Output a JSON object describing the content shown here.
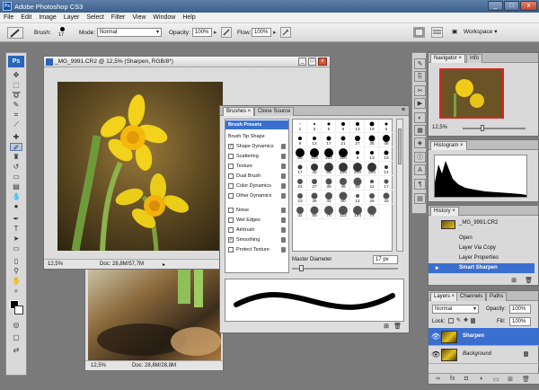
{
  "app": {
    "title": "Adobe Photoshop CS3",
    "logo": "Ps"
  },
  "window_controls": {
    "minimize": "_",
    "maximize": "□",
    "close": "x"
  },
  "menu": [
    "File",
    "Edit",
    "Image",
    "Layer",
    "Select",
    "Filter",
    "View",
    "Window",
    "Help"
  ],
  "options_bar": {
    "brush_label": "Brush:",
    "brush_size": "17",
    "mode_label": "Mode:",
    "mode_value": "Normal",
    "opacity_label": "Opacity:",
    "opacity_value": "100%",
    "flow_label": "Flow:",
    "flow_value": "100%",
    "workspace_label": "Workspace ▾"
  },
  "document_front": {
    "title": "_MG_9991.CR2 @ 12,5% (Sharpen, RGB/8*)",
    "zoom": "12,5%",
    "doc_info": "Doc: 28,8M/57,7M"
  },
  "document_back": {
    "zoom": "12,5%",
    "doc_info": "Doc: 28,8M/28,8M"
  },
  "brushes_panel": {
    "tabs": [
      "Brushes ×",
      "Clone Source"
    ],
    "presets_header": "Brush Presets",
    "tip_shape": "Brush Tip Shape",
    "options": [
      {
        "label": "Shape Dynamics",
        "checked": true,
        "check": "✓"
      },
      {
        "label": "Scattering",
        "checked": false,
        "check": ""
      },
      {
        "label": "Texture",
        "checked": false,
        "check": ""
      },
      {
        "label": "Dual Brush",
        "checked": false,
        "check": ""
      },
      {
        "label": "Color Dynamics",
        "checked": false,
        "check": ""
      },
      {
        "label": "Other Dynamics",
        "checked": false,
        "check": ""
      },
      {
        "label": "Noise",
        "checked": false,
        "check": ""
      },
      {
        "label": "Wet Edges",
        "checked": false,
        "check": ""
      },
      {
        "label": "Airbrush",
        "checked": false,
        "check": ""
      },
      {
        "label": "Smoothing",
        "checked": true,
        "check": "✓"
      },
      {
        "label": "Protect Texture",
        "checked": false,
        "check": ""
      }
    ],
    "brush_sizes": [
      "1",
      "3",
      "5",
      "9",
      "13",
      "19",
      "5",
      "9",
      "13",
      "17",
      "21",
      "27",
      "35",
      "45",
      "65",
      "100",
      "200",
      "300",
      "9",
      "13",
      "19",
      "17",
      "45",
      "65",
      "100",
      "200",
      "300",
      "14",
      "24",
      "27",
      "39",
      "46",
      "59",
      "11",
      "17",
      "23",
      "36",
      "44",
      "60",
      "14",
      "26",
      "33",
      "42",
      "55",
      "70",
      "112",
      "134",
      "74"
    ],
    "master_diameter_label": "Master Diameter",
    "master_diameter_value": "17 px"
  },
  "navigator_panel": {
    "tabs": [
      "Navigator ×",
      "Info"
    ],
    "zoom": "12,5%"
  },
  "histogram_panel": {
    "tabs": [
      "Histogram ×"
    ]
  },
  "history_panel": {
    "tabs": [
      "History ×"
    ],
    "snapshot": "_MG_9991.CR2",
    "items": [
      "Open",
      "Layer Via Copy",
      "Layer Properties",
      "Smart Sharpen"
    ],
    "selected": "Smart Sharpen"
  },
  "layers_panel": {
    "tabs": [
      "Layers ×",
      "Channels",
      "Paths"
    ],
    "blend_mode": "Normal",
    "opacity_label": "Opacity:",
    "opacity_value": "100%",
    "lock_label": "Lock:",
    "fill_label": "Fill:",
    "fill_value": "100%",
    "layers": [
      {
        "name": "Sharpen",
        "selected": true
      },
      {
        "name": "Background",
        "selected": false
      }
    ]
  }
}
